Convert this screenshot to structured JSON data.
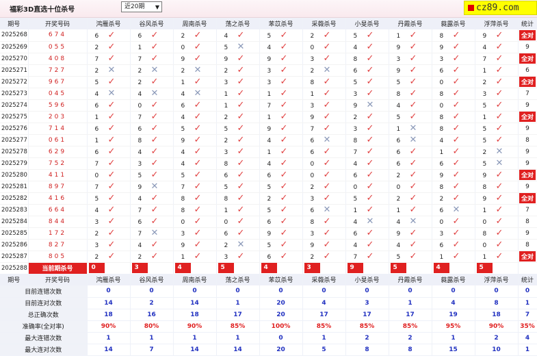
{
  "top": {
    "title": "福彩3D直选十位杀号",
    "period_select": "近20期",
    "brand": "cz89.com"
  },
  "headers": [
    "期号",
    "开奖号码",
    "鸿雁杀号",
    "谷风杀号",
    "周南杀号",
    "荡之杀号",
    "苯苡杀号",
    "采薇杀号",
    "小旻杀号",
    "丹霞杀号",
    "蕤露杀号",
    "浮萍杀号",
    "统计"
  ],
  "rows": [
    {
      "period": "2025268",
      "nums": "674",
      "cells": [
        [
          "6",
          "ok"
        ],
        [
          "6",
          "ok"
        ],
        [
          "2",
          "ok"
        ],
        [
          "4",
          "ok"
        ],
        [
          "5",
          "ok"
        ],
        [
          "2",
          "ok"
        ],
        [
          "5",
          "ok"
        ],
        [
          "1",
          "ok"
        ],
        [
          "8",
          "ok"
        ],
        [
          "9",
          "ok"
        ]
      ],
      "total": "全对"
    },
    {
      "period": "2025269",
      "nums": "055",
      "cells": [
        [
          "2",
          "ok"
        ],
        [
          "1",
          "ok"
        ],
        [
          "0",
          "ok"
        ],
        [
          "5",
          "bad"
        ],
        [
          "4",
          "ok"
        ],
        [
          "0",
          "ok"
        ],
        [
          "4",
          "ok"
        ],
        [
          "9",
          "ok"
        ],
        [
          "9",
          "ok"
        ],
        [
          "4",
          "ok"
        ]
      ],
      "total": "9"
    },
    {
      "period": "2025270",
      "nums": "408",
      "cells": [
        [
          "7",
          "ok"
        ],
        [
          "7",
          "ok"
        ],
        [
          "9",
          "ok"
        ],
        [
          "9",
          "ok"
        ],
        [
          "9",
          "ok"
        ],
        [
          "3",
          "ok"
        ],
        [
          "8",
          "ok"
        ],
        [
          "3",
          "ok"
        ],
        [
          "3",
          "ok"
        ],
        [
          "7",
          "ok"
        ]
      ],
      "total": "全对"
    },
    {
      "period": "2025271",
      "nums": "727",
      "cells": [
        [
          "2",
          "bad"
        ],
        [
          "2",
          "bad"
        ],
        [
          "2",
          "bad"
        ],
        [
          "2",
          "ok"
        ],
        [
          "3",
          "ok"
        ],
        [
          "2",
          "bad"
        ],
        [
          "6",
          "ok"
        ],
        [
          "9",
          "ok"
        ],
        [
          "6",
          "ok"
        ],
        [
          "1",
          "ok"
        ]
      ],
      "total": "6"
    },
    {
      "period": "2025272",
      "nums": "967",
      "cells": [
        [
          "5",
          "ok"
        ],
        [
          "2",
          "ok"
        ],
        [
          "1",
          "ok"
        ],
        [
          "3",
          "ok"
        ],
        [
          "3",
          "ok"
        ],
        [
          "8",
          "ok"
        ],
        [
          "5",
          "ok"
        ],
        [
          "5",
          "ok"
        ],
        [
          "0",
          "ok"
        ],
        [
          "2",
          "ok"
        ]
      ],
      "total": "全对"
    },
    {
      "period": "2025273",
      "nums": "045",
      "cells": [
        [
          "4",
          "bad"
        ],
        [
          "4",
          "bad"
        ],
        [
          "4",
          "bad"
        ],
        [
          "1",
          "ok"
        ],
        [
          "1",
          "ok"
        ],
        [
          "1",
          "ok"
        ],
        [
          "3",
          "ok"
        ],
        [
          "8",
          "ok"
        ],
        [
          "8",
          "ok"
        ],
        [
          "3",
          "ok"
        ]
      ],
      "total": "7"
    },
    {
      "period": "2025274",
      "nums": "596",
      "cells": [
        [
          "6",
          "ok"
        ],
        [
          "0",
          "ok"
        ],
        [
          "6",
          "ok"
        ],
        [
          "1",
          "ok"
        ],
        [
          "7",
          "ok"
        ],
        [
          "3",
          "ok"
        ],
        [
          "9",
          "bad"
        ],
        [
          "4",
          "ok"
        ],
        [
          "0",
          "ok"
        ],
        [
          "5",
          "ok"
        ]
      ],
      "total": "9"
    },
    {
      "period": "2025275",
      "nums": "203",
      "cells": [
        [
          "1",
          "ok"
        ],
        [
          "7",
          "ok"
        ],
        [
          "4",
          "ok"
        ],
        [
          "2",
          "ok"
        ],
        [
          "1",
          "ok"
        ],
        [
          "9",
          "ok"
        ],
        [
          "2",
          "ok"
        ],
        [
          "5",
          "ok"
        ],
        [
          "8",
          "ok"
        ],
        [
          "1",
          "ok"
        ]
      ],
      "total": "全对"
    },
    {
      "period": "2025276",
      "nums": "714",
      "cells": [
        [
          "6",
          "ok"
        ],
        [
          "6",
          "ok"
        ],
        [
          "5",
          "ok"
        ],
        [
          "5",
          "ok"
        ],
        [
          "9",
          "ok"
        ],
        [
          "7",
          "ok"
        ],
        [
          "3",
          "ok"
        ],
        [
          "1",
          "bad"
        ],
        [
          "8",
          "ok"
        ],
        [
          "5",
          "ok"
        ]
      ],
      "total": "9"
    },
    {
      "period": "2025277",
      "nums": "061",
      "cells": [
        [
          "1",
          "ok"
        ],
        [
          "8",
          "ok"
        ],
        [
          "9",
          "ok"
        ],
        [
          "2",
          "ok"
        ],
        [
          "4",
          "ok"
        ],
        [
          "6",
          "bad"
        ],
        [
          "8",
          "ok"
        ],
        [
          "6",
          "bad"
        ],
        [
          "4",
          "ok"
        ],
        [
          "5",
          "ok"
        ]
      ],
      "total": "8"
    },
    {
      "period": "2025278",
      "nums": "629",
      "cells": [
        [
          "6",
          "ok"
        ],
        [
          "4",
          "ok"
        ],
        [
          "4",
          "ok"
        ],
        [
          "3",
          "ok"
        ],
        [
          "1",
          "ok"
        ],
        [
          "6",
          "ok"
        ],
        [
          "7",
          "ok"
        ],
        [
          "6",
          "ok"
        ],
        [
          "1",
          "ok"
        ],
        [
          "2",
          "bad"
        ]
      ],
      "total": "9"
    },
    {
      "period": "2025279",
      "nums": "752",
      "cells": [
        [
          "7",
          "ok"
        ],
        [
          "3",
          "ok"
        ],
        [
          "4",
          "ok"
        ],
        [
          "8",
          "ok"
        ],
        [
          "4",
          "ok"
        ],
        [
          "0",
          "ok"
        ],
        [
          "4",
          "ok"
        ],
        [
          "6",
          "ok"
        ],
        [
          "6",
          "ok"
        ],
        [
          "5",
          "bad"
        ]
      ],
      "total": "9"
    },
    {
      "period": "2025280",
      "nums": "411",
      "cells": [
        [
          "0",
          "ok"
        ],
        [
          "5",
          "ok"
        ],
        [
          "5",
          "ok"
        ],
        [
          "6",
          "ok"
        ],
        [
          "6",
          "ok"
        ],
        [
          "0",
          "ok"
        ],
        [
          "6",
          "ok"
        ],
        [
          "2",
          "ok"
        ],
        [
          "9",
          "ok"
        ],
        [
          "9",
          "ok"
        ]
      ],
      "total": "全对"
    },
    {
      "period": "2025281",
      "nums": "897",
      "cells": [
        [
          "7",
          "ok"
        ],
        [
          "9",
          "bad"
        ],
        [
          "7",
          "ok"
        ],
        [
          "5",
          "ok"
        ],
        [
          "5",
          "ok"
        ],
        [
          "2",
          "ok"
        ],
        [
          "0",
          "ok"
        ],
        [
          "0",
          "ok"
        ],
        [
          "8",
          "ok"
        ],
        [
          "8",
          "ok"
        ]
      ],
      "total": "9"
    },
    {
      "period": "2025282",
      "nums": "416",
      "cells": [
        [
          "5",
          "ok"
        ],
        [
          "4",
          "ok"
        ],
        [
          "8",
          "ok"
        ],
        [
          "8",
          "ok"
        ],
        [
          "2",
          "ok"
        ],
        [
          "3",
          "ok"
        ],
        [
          "5",
          "ok"
        ],
        [
          "2",
          "ok"
        ],
        [
          "2",
          "ok"
        ],
        [
          "9",
          "ok"
        ]
      ],
      "total": "全对"
    },
    {
      "period": "2025283",
      "nums": "664",
      "cells": [
        [
          "4",
          "ok"
        ],
        [
          "7",
          "ok"
        ],
        [
          "8",
          "ok"
        ],
        [
          "1",
          "ok"
        ],
        [
          "5",
          "ok"
        ],
        [
          "6",
          "bad"
        ],
        [
          "1",
          "ok"
        ],
        [
          "1",
          "ok"
        ],
        [
          "6",
          "bad"
        ],
        [
          "1",
          "ok"
        ]
      ],
      "total": "7"
    },
    {
      "period": "2025284",
      "nums": "844",
      "cells": [
        [
          "3",
          "ok"
        ],
        [
          "6",
          "ok"
        ],
        [
          "0",
          "ok"
        ],
        [
          "0",
          "ok"
        ],
        [
          "6",
          "ok"
        ],
        [
          "8",
          "ok"
        ],
        [
          "4",
          "bad"
        ],
        [
          "4",
          "bad"
        ],
        [
          "0",
          "ok"
        ],
        [
          "0",
          "ok"
        ]
      ],
      "total": "8"
    },
    {
      "period": "2025285",
      "nums": "172",
      "cells": [
        [
          "2",
          "ok"
        ],
        [
          "7",
          "bad"
        ],
        [
          "3",
          "ok"
        ],
        [
          "6",
          "ok"
        ],
        [
          "9",
          "ok"
        ],
        [
          "3",
          "ok"
        ],
        [
          "6",
          "ok"
        ],
        [
          "9",
          "ok"
        ],
        [
          "3",
          "ok"
        ],
        [
          "8",
          "ok"
        ]
      ],
      "total": "9"
    },
    {
      "period": "2025286",
      "nums": "827",
      "cells": [
        [
          "3",
          "ok"
        ],
        [
          "4",
          "ok"
        ],
        [
          "9",
          "ok"
        ],
        [
          "2",
          "bad"
        ],
        [
          "5",
          "ok"
        ],
        [
          "9",
          "ok"
        ],
        [
          "4",
          "ok"
        ],
        [
          "4",
          "ok"
        ],
        [
          "6",
          "ok"
        ],
        [
          "0",
          "ok"
        ]
      ],
      "total": "8"
    },
    {
      "period": "2025287",
      "nums": "805",
      "cells": [
        [
          "2",
          "ok"
        ],
        [
          "2",
          "ok"
        ],
        [
          "1",
          "ok"
        ],
        [
          "3",
          "ok"
        ],
        [
          "6",
          "ok"
        ],
        [
          "2",
          "ok"
        ],
        [
          "7",
          "ok"
        ],
        [
          "5",
          "ok"
        ],
        [
          "1",
          "ok"
        ],
        [
          "1",
          "ok"
        ]
      ],
      "total": "全对"
    }
  ],
  "current": {
    "period": "2025288",
    "label": "当前期杀号",
    "values": [
      "0",
      "3",
      "4",
      "5",
      "4",
      "3",
      "9",
      "5",
      "4",
      "5"
    ]
  },
  "stats": [
    {
      "label": "目前连错次数",
      "color": "blue",
      "values": [
        "0",
        "0",
        "0",
        "0",
        "0",
        "0",
        "0",
        "0",
        "0",
        "0",
        "0"
      ]
    },
    {
      "label": "目前连对次数",
      "color": "blue",
      "values": [
        "14",
        "2",
        "14",
        "1",
        "20",
        "4",
        "3",
        "1",
        "4",
        "8",
        "1"
      ]
    },
    {
      "label": "总正确次数",
      "color": "blue",
      "values": [
        "18",
        "16",
        "18",
        "17",
        "20",
        "17",
        "17",
        "17",
        "19",
        "18",
        "7"
      ]
    },
    {
      "label": "准确率(全对率)",
      "color": "red",
      "values": [
        "90%",
        "80%",
        "90%",
        "85%",
        "100%",
        "85%",
        "85%",
        "85%",
        "95%",
        "90%",
        "35%"
      ]
    },
    {
      "label": "最大连错次数",
      "color": "blue",
      "values": [
        "1",
        "1",
        "1",
        "1",
        "0",
        "1",
        "2",
        "2",
        "1",
        "2",
        "4"
      ]
    },
    {
      "label": "最大连对次数",
      "color": "blue",
      "values": [
        "14",
        "7",
        "14",
        "14",
        "20",
        "5",
        "8",
        "8",
        "15",
        "10",
        "1"
      ]
    }
  ],
  "colors": {
    "accent_red": "#e02020",
    "check_red": "#e04040",
    "cross_gray": "#8a98b8",
    "stat_blue": "#2030c0",
    "header_bg": "#eef0f8"
  },
  "icons": {
    "ok": "check-icon",
    "bad": "cross-icon"
  }
}
